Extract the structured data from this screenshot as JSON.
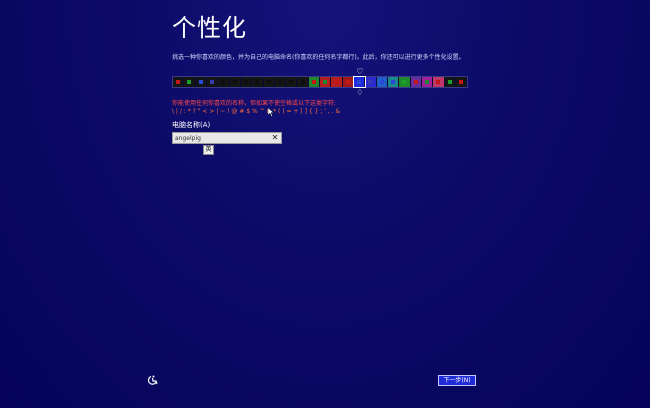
{
  "page": {
    "title": "个性化",
    "description": "挑选一种你喜欢的颜色，并为自己的电脑命名(你喜欢的任何名字都行)。此后，你还可以进行更多个性化设置。"
  },
  "colors": {
    "selected_index": 16,
    "swatches": [
      {
        "bg": "#151515",
        "dot": "#c21818"
      },
      {
        "bg": "#151515",
        "dot": "#1ea02b"
      },
      {
        "bg": "#151515",
        "dot": "#2b49d8"
      },
      {
        "bg": "#151515",
        "dot": "#3a3ab0"
      },
      {
        "bg": "#151515",
        "dot": "#0e0e0e"
      },
      {
        "bg": "#151515",
        "dot": "#0e0e0e"
      },
      {
        "bg": "#151515",
        "dot": "#0e0e0e"
      },
      {
        "bg": "#151515",
        "dot": "#0e0e0e"
      },
      {
        "bg": "#151515",
        "dot": "#0e0e0e"
      },
      {
        "bg": "#151515",
        "dot": "#0e0e0e"
      },
      {
        "bg": "#151515",
        "dot": "#0e0e0e"
      },
      {
        "bg": "#151515",
        "dot": "#0e0e0e"
      },
      {
        "bg": "#1e8a2c",
        "dot": "#c21818"
      },
      {
        "bg": "#b51e1e",
        "dot": "#1e8a2c"
      },
      {
        "bg": "#b51e1e",
        "dot": "#c21818"
      },
      {
        "bg": "#a0181a",
        "dot": "#c21818"
      },
      {
        "bg": "#1f2be0",
        "dot": "#2b49d8"
      },
      {
        "bg": "#2a2ad0",
        "dot": "#3a3ab0"
      },
      {
        "bg": "#1e5fc8",
        "dot": "#2b49d8"
      },
      {
        "bg": "#1a8a8a",
        "dot": "#2b49d8"
      },
      {
        "bg": "#1e8a2c",
        "dot": "#1ea02b"
      },
      {
        "bg": "#6a2ea0",
        "dot": "#c21818"
      },
      {
        "bg": "#a0209a",
        "dot": "#1e8a2c"
      },
      {
        "bg": "#c0386a",
        "dot": "#c21818"
      },
      {
        "bg": "#151515",
        "dot": "#1ea02b"
      },
      {
        "bg": "#151515",
        "dot": "#c21818"
      }
    ],
    "marker_top": "♡",
    "marker_bottom": "♢"
  },
  "warning": {
    "line1": "你能使用任何你喜欢的名称，但如果不使空格或以下这类字符:",
    "line2": "\\ | / : * ? \" < > | ~ ! @ # $ % ^ & * ( ) = + [ ] { } ; ' , . &"
  },
  "name_field": {
    "label": "电脑名称(A)",
    "value": "angelpig",
    "clear_glyph": "✕"
  },
  "ime": {
    "indicator": "英"
  },
  "footer": {
    "next_label": "下一步(N)"
  },
  "icons": {
    "accessibility": "accessibility-icon",
    "cursor": "mouse-cursor-icon"
  }
}
